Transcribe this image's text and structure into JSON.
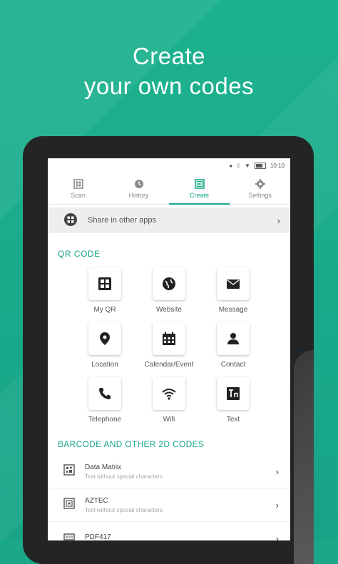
{
  "headline": {
    "line1": "Create",
    "line2": "your own codes"
  },
  "statusbar": {
    "time": "10:10"
  },
  "tabs": [
    {
      "label": "Scan",
      "icon": "barcode-scan-icon"
    },
    {
      "label": "History",
      "icon": "history-icon"
    },
    {
      "label": "Create",
      "icon": "qr-create-icon",
      "active": true
    },
    {
      "label": "Settings",
      "icon": "gear-icon"
    }
  ],
  "share": {
    "label": "Share in other apps",
    "icon": "share-apps-icon"
  },
  "qr_section": {
    "title": "QR CODE",
    "items": [
      {
        "label": "My QR",
        "icon": "contact-card-icon"
      },
      {
        "label": "Website",
        "icon": "globe-icon"
      },
      {
        "label": "Message",
        "icon": "envelope-icon"
      },
      {
        "label": "Location",
        "icon": "location-pin-icon"
      },
      {
        "label": "Calendar/Event",
        "icon": "calendar-icon"
      },
      {
        "label": "Contact",
        "icon": "person-icon"
      },
      {
        "label": "Telephone",
        "icon": "phone-icon"
      },
      {
        "label": "Wifi",
        "icon": "wifi-icon"
      },
      {
        "label": "Text",
        "icon": "text-icon"
      }
    ]
  },
  "barcode_section": {
    "title": "BARCODE AND OTHER 2D CODES",
    "items": [
      {
        "title": "Data Matrix",
        "subtitle": "Text without special characters"
      },
      {
        "title": "AZTEC",
        "subtitle": "Text without special characters"
      },
      {
        "title": "PDF417",
        "subtitle": ""
      }
    ]
  },
  "colors": {
    "accent": "#1aa889",
    "background": "#1db28f"
  }
}
